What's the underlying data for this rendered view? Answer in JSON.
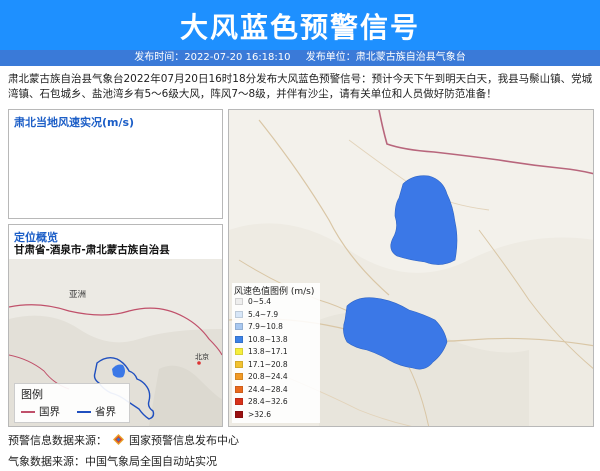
{
  "header": {
    "title": "大风蓝色预警信号",
    "publish_time_label": "发布时间：2022-07-20 16:18:10",
    "publisher_label": "发布单位：肃北蒙古族自治县气象台"
  },
  "notice": {
    "text": "肃北蒙古族自治县气象台2022年07月20日16时18分发布大风蓝色预警信号：预计今天下午到明天白天，我县马鬃山镇、党城湾镇、石包城乡、盐池湾乡有5～6级大风，阵风7～8级，并伴有沙尘，请有关单位和人员做好防范准备！"
  },
  "wind_panel": {
    "title": "肃北当地风速实况(m/s)"
  },
  "location_panel": {
    "title": "定位概览",
    "region": "甘肃省-酒泉市-肃北蒙古族自治县",
    "map_labels": {
      "asia": "亚洲",
      "beijing": "北京"
    },
    "legend": {
      "title": "图例",
      "national_border": "国界",
      "provincial_border": "省界",
      "national_color": "#c0506a",
      "provincial_color": "#1f4fbf"
    }
  },
  "wind_scale": {
    "title": "风速色值图例 (m/s)",
    "items": [
      {
        "label": "0~5.4",
        "color": "#eeeeee"
      },
      {
        "label": "5.4~7.9",
        "color": "#d7e6f7"
      },
      {
        "label": "7.9~10.8",
        "color": "#a8c8f0"
      },
      {
        "label": "10.8~13.8",
        "color": "#3c82e6"
      },
      {
        "label": "13.8~17.1",
        "color": "#f6ee3c"
      },
      {
        "label": "17.1~20.8",
        "color": "#f2c230"
      },
      {
        "label": "20.8~24.4",
        "color": "#f29a26"
      },
      {
        "label": "24.4~28.4",
        "color": "#ea6a1e"
      },
      {
        "label": "28.4~32.6",
        "color": "#d8321a"
      },
      {
        "label": ">32.6",
        "color": "#9a1010"
      }
    ]
  },
  "warning_area_color": "#3b78e7",
  "footer": {
    "warning_source": "预警信息数据来源：",
    "warning_source_org": "国家预警信息发布中心",
    "weather_source": "气象数据来源：中国气象局全国自动站实况"
  }
}
